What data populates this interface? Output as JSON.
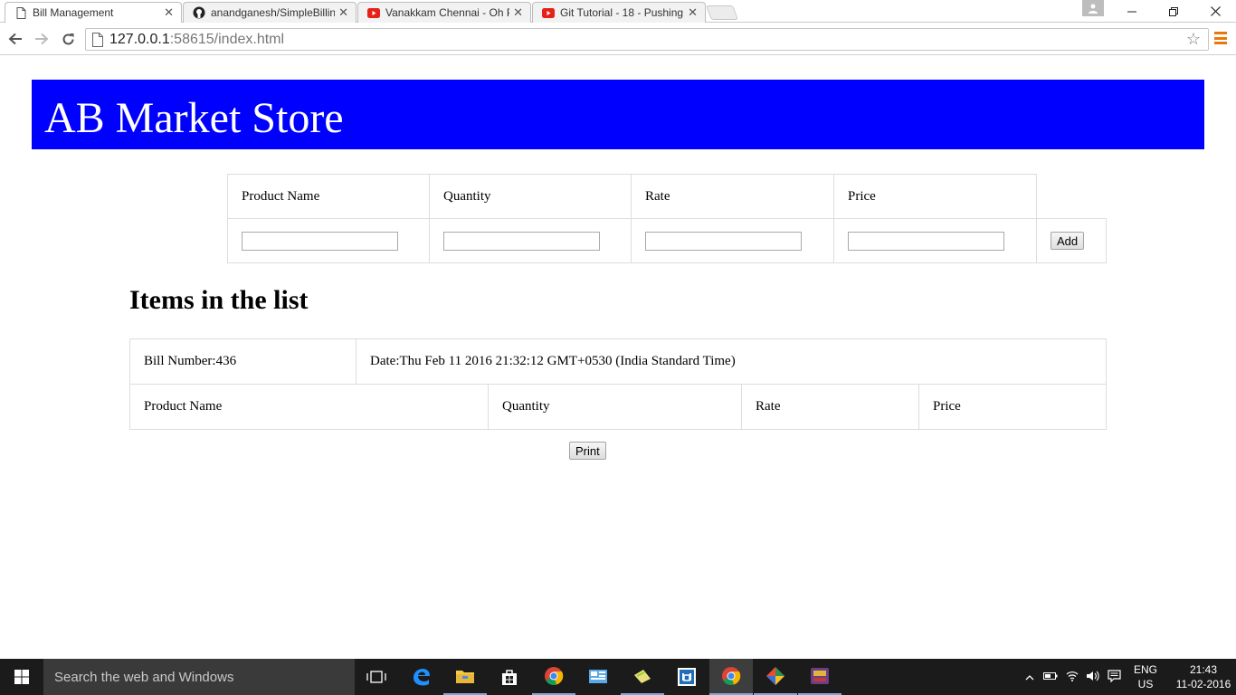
{
  "browser": {
    "tabs": [
      {
        "title": "Bill Management",
        "icon": "document-icon",
        "active": true
      },
      {
        "title": "anandganesh/SimpleBillin",
        "icon": "github-icon",
        "active": false
      },
      {
        "title": "Vanakkam Chennai - Oh P",
        "icon": "youtube-icon",
        "active": false
      },
      {
        "title": "Git Tutorial - 18 - Pushing",
        "icon": "youtube-icon",
        "active": false
      }
    ],
    "close_glyph": "✕",
    "url_host": "127.0.0.1",
    "url_rest": ":58615/index.html"
  },
  "page": {
    "store_title": "AB Market Store",
    "entry_headers": [
      "Product Name",
      "Quantity",
      "Rate",
      "Price"
    ],
    "entry_inputs": {
      "product": "",
      "quantity": "",
      "rate": "",
      "price": ""
    },
    "add_label": "Add",
    "list_heading": "Items in the list",
    "bill_number": "Bill Number:436",
    "bill_date": "Date:Thu Feb 11 2016 21:32:12 GMT+0530 (India Standard Time)",
    "list_headers": [
      "Product Name",
      "Quantity",
      "Rate",
      "Price"
    ],
    "print_label": "Print"
  },
  "taskbar": {
    "search_placeholder": "Search the web and Windows",
    "language": "ENG",
    "region": "US",
    "time": "21:43",
    "date": "11-02-2016"
  },
  "colors": {
    "header_bg": "#0000ff",
    "header_text": "#ffffff",
    "taskbar_bg": "#1b1b1b"
  }
}
